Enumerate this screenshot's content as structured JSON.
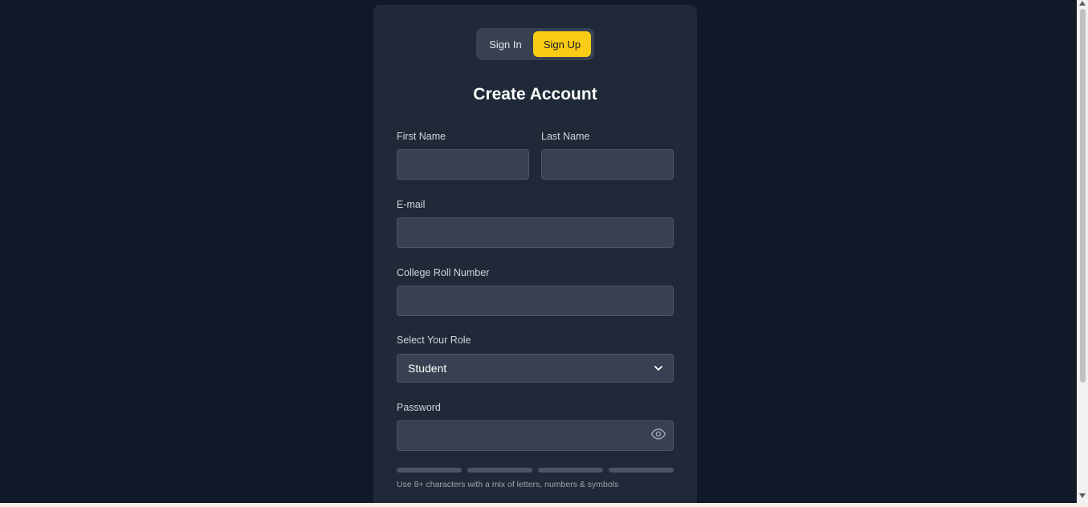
{
  "auth_toggle": {
    "sign_in_label": "Sign In",
    "sign_up_label": "Sign Up",
    "active": "Sign Up"
  },
  "form": {
    "title": "Create Account",
    "first_name": {
      "label": "First Name",
      "value": ""
    },
    "last_name": {
      "label": "Last Name",
      "value": ""
    },
    "email": {
      "label": "E-mail",
      "value": ""
    },
    "roll_number": {
      "label": "College Roll Number",
      "value": ""
    },
    "role": {
      "label": "Select Your Role",
      "selected": "Student"
    },
    "password": {
      "label": "Password",
      "value": "",
      "visibility_icon": "eye-icon",
      "strength_segments_filled": 0,
      "strength_segments_total": 4,
      "hint": "Use 8+ characters with a mix of letters, numbers & symbols"
    }
  },
  "colors": {
    "page_background": "#111827",
    "card_background": "#1f2937",
    "input_background": "#374151",
    "accent": "#facc15",
    "strength_empty": "#4b5563"
  }
}
